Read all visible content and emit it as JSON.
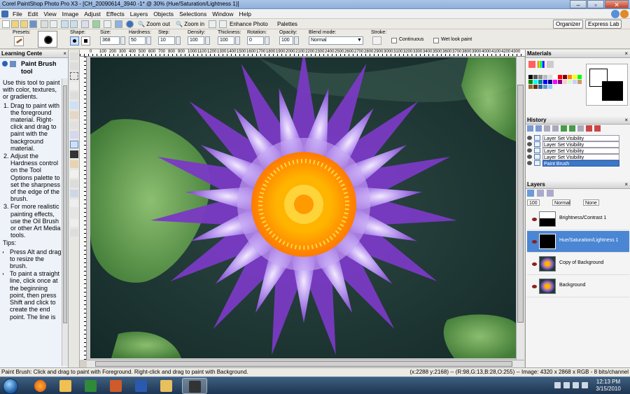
{
  "window": {
    "title": "Corel PaintShop Photo Pro X3 - [CH_20090614_3940 -1* @ 30% (Hue/Saturation/Lightness 1)]"
  },
  "menu": [
    "File",
    "Edit",
    "View",
    "Image",
    "Adjust",
    "Effects",
    "Layers",
    "Objects",
    "Selections",
    "Window",
    "Help"
  ],
  "toolbar": {
    "zoom_out": "Zoom out",
    "zoom_in": "Zoom in",
    "enhance_photo": "Enhance Photo",
    "palettes": "Palettes",
    "organizer": "Organizer",
    "express_lab": "Express Lab"
  },
  "options": {
    "presets_label": "Presets:",
    "shape_label": "Shape:",
    "size_label": "Size:",
    "size_value": "368",
    "hardness_label": "Hardness:",
    "hardness_value": "50",
    "step_label": "Step:",
    "step_value": "10",
    "density_label": "Density:",
    "density_value": "100",
    "thickness_label": "Thickness:",
    "thickness_value": "100",
    "rotation_label": "Rotation:",
    "rotation_value": "0",
    "opacity_label": "Opacity:",
    "opacity_value": "100",
    "blend_label": "Blend mode:",
    "blend_value": "Normal",
    "stroke_label": "Stroke:",
    "continuous_label": "Continuous",
    "wet_look_label": "Wet look paint"
  },
  "learning_center": {
    "title": "Learning Cente",
    "tool_name": "Paint Brush tool",
    "intro": "Use this tool to paint with color, textures, or gradients.",
    "steps": [
      "Drag to paint with the foreground material. Right-click and drag to paint with the background material.",
      "Adjust the Hardness control on the Tool Options palette to set the sharpness of the edge of the brush.",
      "For more realistic painting effects, use the Oil Brush or other Art Media tools."
    ],
    "tips_label": "Tips:",
    "tips": [
      "Press Alt and drag to resize the brush.",
      "To paint a straight line, click once at the beginning point, then press Shift and click to create the end point. The line is"
    ]
  },
  "ruler_labels": [
    "0",
    "100",
    "200",
    "300",
    "400",
    "500",
    "600",
    "700",
    "800",
    "900",
    "1000",
    "1100",
    "1200",
    "1300",
    "1400",
    "1500",
    "1600",
    "1700",
    "1800",
    "1900",
    "2000",
    "2100",
    "2200",
    "2300",
    "2400",
    "2500",
    "2600",
    "2700",
    "2800",
    "2900",
    "3000",
    "3100",
    "3200",
    "3300",
    "3400",
    "3500",
    "3600",
    "3700",
    "3800",
    "3900",
    "4000",
    "4100",
    "4200",
    "4300"
  ],
  "materials": {
    "title": "Materials"
  },
  "history": {
    "title": "History",
    "items": [
      "Layer Set Visibility",
      "Layer Set Visibility",
      "Layer Set Visibility",
      "Layer Set Visibility",
      "Paint Brush"
    ],
    "selected_index": 4
  },
  "layers": {
    "title": "Layers",
    "opacity": "100",
    "blend": "Normal",
    "lock": "None",
    "items": [
      {
        "name": "Brightness/Contrast 1"
      },
      {
        "name": "Hue/Saturation/Lightness 1"
      },
      {
        "name": "Copy of Background"
      },
      {
        "name": "Background"
      }
    ],
    "selected_index": 1
  },
  "status": {
    "left": "Paint Brush: Click and drag to paint with Foreground. Right-click and drag to paint with Background.",
    "right": "(x:2288 y:2168) -- (R:98,G:13,B:28,O:255) -- Image:  4320 x 2868 x RGB - 8 bits/channel"
  },
  "taskbar": {
    "time": "12:13 PM",
    "date": "3/15/2010"
  },
  "colors": {
    "title_bar": "#a9c4e6",
    "selection": "#3a78c8",
    "canvas_bg": "#1d3a35",
    "petal": "#8e5fd6",
    "center": "#f8c400"
  }
}
